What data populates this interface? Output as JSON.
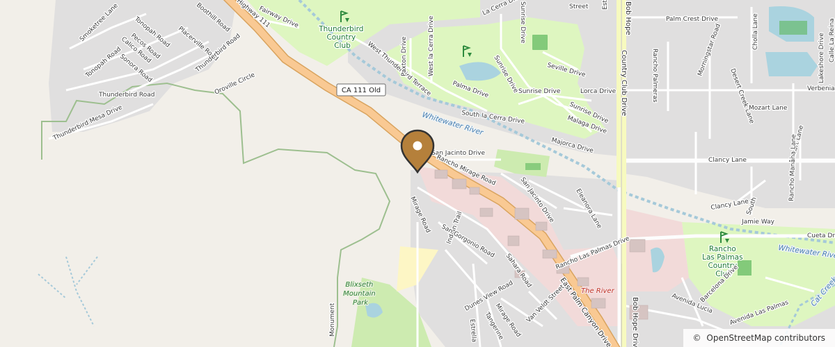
{
  "map": {
    "attribution": {
      "symbol": "©",
      "text": "OpenStreetMap contributors"
    },
    "route_shield": "CA 111 Old",
    "marker": {
      "icon": "map-pin-icon",
      "color": "#b5803b"
    },
    "colors": {
      "land": "#f2efe9",
      "residential": "#e0dfdf",
      "golf": "#def6c0",
      "park": "#cdebb0",
      "commercial": "#f2dad9",
      "water": "#aad3df",
      "primary_road": "#f9c993",
      "river_line": "#a5c9d9"
    },
    "places": {
      "thunderbird_cc": [
        "Thunderbird",
        "Country",
        "Club"
      ],
      "rancho_las_palmas_cc": [
        "Rancho",
        "Las Palmas",
        "Country",
        "Club"
      ],
      "blixseth_park": [
        "Blixseth",
        "Mountain",
        "Park"
      ],
      "the_river": "The River",
      "whitewater_river_1": "Whitewater River",
      "whitewater_river_2": "Whitewater River",
      "cat_creek": "Cat Creek"
    },
    "roads": {
      "smoketree": "Smoketree Lane",
      "tonopah_upper": "Tonopah Road",
      "tonopah_lower": "Tonopah Road",
      "pecos": "Pecos Road",
      "boothill": "Boothill Road",
      "placerville": "Placerville Road",
      "calico": "Calico Road",
      "sonora": "Sonora Road",
      "thunderbird_upper": "Thunderbird Road",
      "thunderbird_lower": "Thunderbird Road",
      "thunderbird_mesa": "Thunderbird Mesa Drive",
      "oroville": "Oroville Circle",
      "fairway": "Fairway Drive",
      "highway_top": "Highway 111",
      "west_thunderbird": "West Thunderbird Terrace",
      "paxton": "Paxton Drive",
      "west_la_cerra": "West la Cerra Drive",
      "la_cerra": "La Cerra Drive",
      "palma": "Palma Drive",
      "sunrise_1": "Sunrise Drive",
      "sunrise_2": "Sunrise Drive",
      "sunrise_3": "Sunrise Drive",
      "sunrise_top": "Sunrise Drive",
      "south_la_cerra": "South la Cerra Drive",
      "seville": "Seville Drive",
      "lorca": "Lorca Drive",
      "malaga": "Malaga Drive",
      "majorca": "Majorca Drive",
      "palm_crest": "Palm Crest Drive",
      "country_club": "Country Club Drive",
      "bob_hope_top": "Bob Hope",
      "bob_hope_bottom": "Bob Hope Drive",
      "rancho_palmeras": "Rancho Palmeras",
      "morningstar": "Morningstar Road",
      "desert_creek": "Desert Creek Lane",
      "cholla": "Cholla Lane",
      "lakeshore": "Lakeshore Drive",
      "calle_la_reina": "Calle La Reina",
      "verbenia": "Verbenia Road",
      "mozart_1": "Mozart Lane",
      "mozart_2": "Mozart Lane",
      "clancy_1": "Clancy Lane",
      "clancy_2": "Clancy Lane",
      "south": "South",
      "jamie": "Jamie Way",
      "rancho_manana": "Rancho Manana Lane",
      "cueta": "Cueta Drive",
      "san_jacinto_1": "San Jacinto Drive",
      "san_jacinto_2": "San Jacinto Drive",
      "rancho_mirage": "Rancho Mirage Road",
      "eleanora": "Eleanora Lane",
      "mirage": "Mirage Road",
      "indian_trail": "Indian Trail",
      "san_gorgonio": "San Gorgonio Road",
      "sahara": "Sahara Road",
      "dunes_view": "Dunes View Road",
      "mirage_2": "Mirage Road",
      "tangerine": "Tangerine",
      "estrella": "Estrella",
      "van_veldt": "Van Veldt Street",
      "rancho_las_palmas_dr": "Rancho Las Palmas Drive",
      "east_palm_canyon": "East Palm Canyon Drive",
      "avenida_las_palmas": "Avenida Las Palmas",
      "barcelona": "Barcelona Drive",
      "avenida_lucia": "Avenida Lucia",
      "monument": "Monument",
      "street_top": "Street",
      "estrella_top": "Estr"
    }
  }
}
